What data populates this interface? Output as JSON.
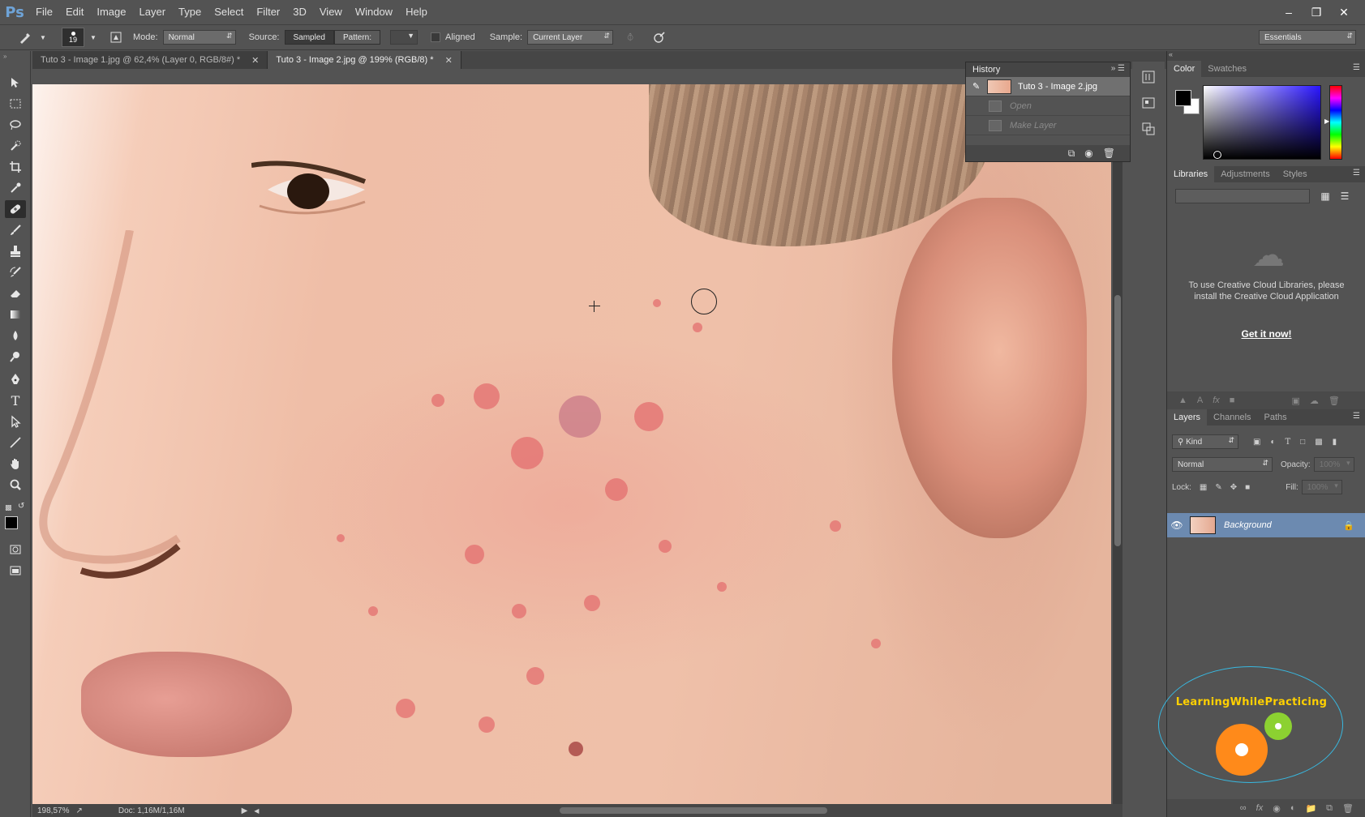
{
  "app": {
    "logo": "Ps"
  },
  "menu": [
    "File",
    "Edit",
    "Image",
    "Layer",
    "Type",
    "Select",
    "Filter",
    "3D",
    "View",
    "Window",
    "Help"
  ],
  "window_controls": [
    "minimize",
    "restore",
    "close"
  ],
  "options": {
    "brush_size": "19",
    "mode_label": "Mode:",
    "mode_value": "Normal",
    "source_label": "Source:",
    "source_sampled": "Sampled",
    "source_pattern": "Pattern:",
    "aligned_label": "Aligned",
    "sample_label": "Sample:",
    "sample_value": "Current Layer",
    "workspace": "Essentials"
  },
  "tabs": [
    {
      "label": "Tuto 3 - Image 1.jpg @ 62,4% (Layer 0, RGB/8#) *",
      "active": false
    },
    {
      "label": "Tuto 3 - Image 2.jpg @ 199% (RGB/8) *",
      "active": true
    }
  ],
  "tools": [
    "move-icon",
    "marquee-icon",
    "lasso-icon",
    "quick-select-icon",
    "crop-icon",
    "eyedropper-icon",
    "healing-brush-icon",
    "brush-icon",
    "clone-stamp-icon",
    "history-brush-icon",
    "eraser-icon",
    "gradient-icon",
    "blur-icon",
    "dodge-icon",
    "pen-icon",
    "type-icon",
    "path-select-icon",
    "line-icon",
    "hand-icon",
    "zoom-icon"
  ],
  "history": {
    "title": "History",
    "items": [
      {
        "label": "Tuto 3 - Image 2.jpg",
        "selected": true
      },
      {
        "label": "Open",
        "selected": false
      },
      {
        "label": "Make Layer",
        "selected": false
      }
    ]
  },
  "color_panel": {
    "tabs": [
      "Color",
      "Swatches"
    ],
    "foreground": "#000000",
    "background": "#ffffff"
  },
  "libraries_panel": {
    "tabs": [
      "Libraries",
      "Adjustments",
      "Styles"
    ],
    "message": "To use Creative Cloud Libraries, please install the Creative Cloud Application",
    "link": "Get it now!"
  },
  "layers_panel": {
    "tabs": [
      "Layers",
      "Channels",
      "Paths"
    ],
    "kind_filter": "Kind",
    "blend_mode": "Normal",
    "opacity_label": "Opacity:",
    "opacity_value": "100%",
    "lock_label": "Lock:",
    "fill_label": "Fill:",
    "fill_value": "100%",
    "layers": [
      {
        "name": "Background",
        "locked": true
      }
    ]
  },
  "status": {
    "zoom": "198,57%",
    "doc": "Doc: 1,16M/1,16M"
  },
  "watermark": {
    "text": "LearningWhilePracticing"
  }
}
